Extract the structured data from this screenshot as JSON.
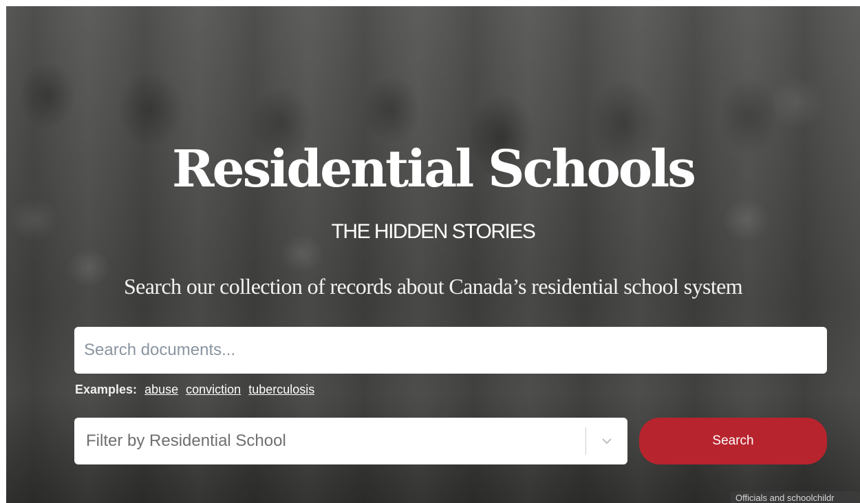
{
  "hero": {
    "title": "Residential Schools",
    "subtitle": "THE HIDDEN STORIES",
    "tagline": "Search our collection of records about Canada’s residential school system"
  },
  "search": {
    "placeholder": "Search documents...",
    "examples_label": "Examples:",
    "examples": [
      "abuse",
      "conviction",
      "tuberculosis"
    ]
  },
  "filter": {
    "placeholder": "Filter by Residential School",
    "icon": "chevron-down-icon"
  },
  "search_button": {
    "label": "Search",
    "color": "#b8242d"
  },
  "photo": {
    "caption": "Officials and schoolchildr"
  }
}
